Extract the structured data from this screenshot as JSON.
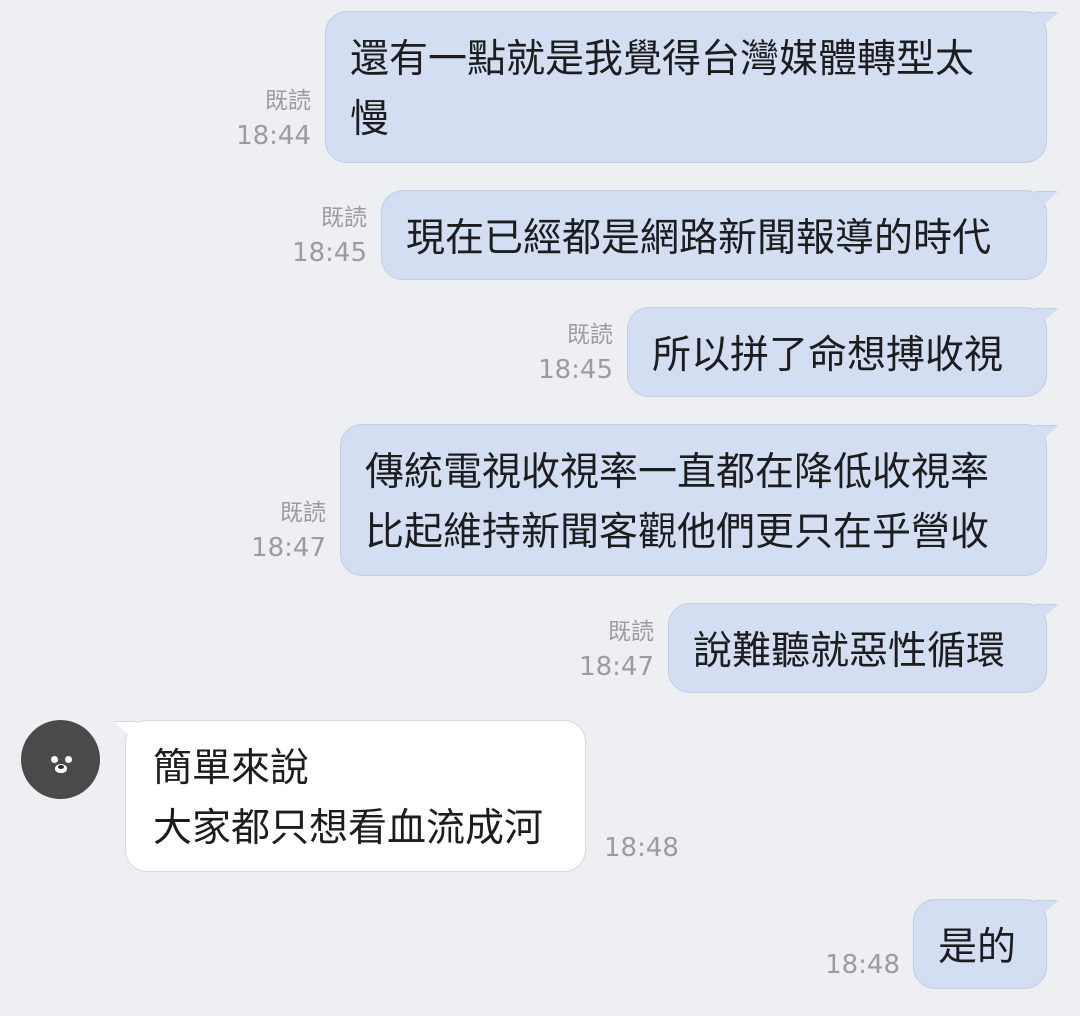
{
  "messages": [
    {
      "direction": "outgoing",
      "lines": [
        "還有一點就是我覺得台灣媒體轉型太",
        "慢"
      ],
      "read_label": "既読",
      "time": "18:44"
    },
    {
      "direction": "outgoing",
      "lines": [
        "現在已經都是網路新聞報導的時代"
      ],
      "read_label": "既読",
      "time": "18:45"
    },
    {
      "direction": "outgoing",
      "lines": [
        "所以拼了命想搏收視"
      ],
      "read_label": "既読",
      "time": "18:45"
    },
    {
      "direction": "outgoing",
      "lines": [
        "傳統電視收視率一直都在降低收視率",
        "比起維持新聞客觀他們更只在乎營收"
      ],
      "read_label": "既読",
      "time": "18:47"
    },
    {
      "direction": "outgoing",
      "lines": [
        "說難聽就惡性循環"
      ],
      "read_label": "既読",
      "time": "18:47"
    },
    {
      "direction": "incoming",
      "avatar": "bear-avatar-icon",
      "lines": [
        "簡單來說",
        "大家都只想看血流成河"
      ],
      "time": "18:48"
    },
    {
      "direction": "outgoing",
      "lines": [
        "是的"
      ],
      "time": "18:48"
    }
  ],
  "colors": {
    "background": "#eeeff3",
    "outgoing_bubble": "#d3def3",
    "incoming_bubble": "#ffffff",
    "meta_text": "#9b9ca1"
  }
}
